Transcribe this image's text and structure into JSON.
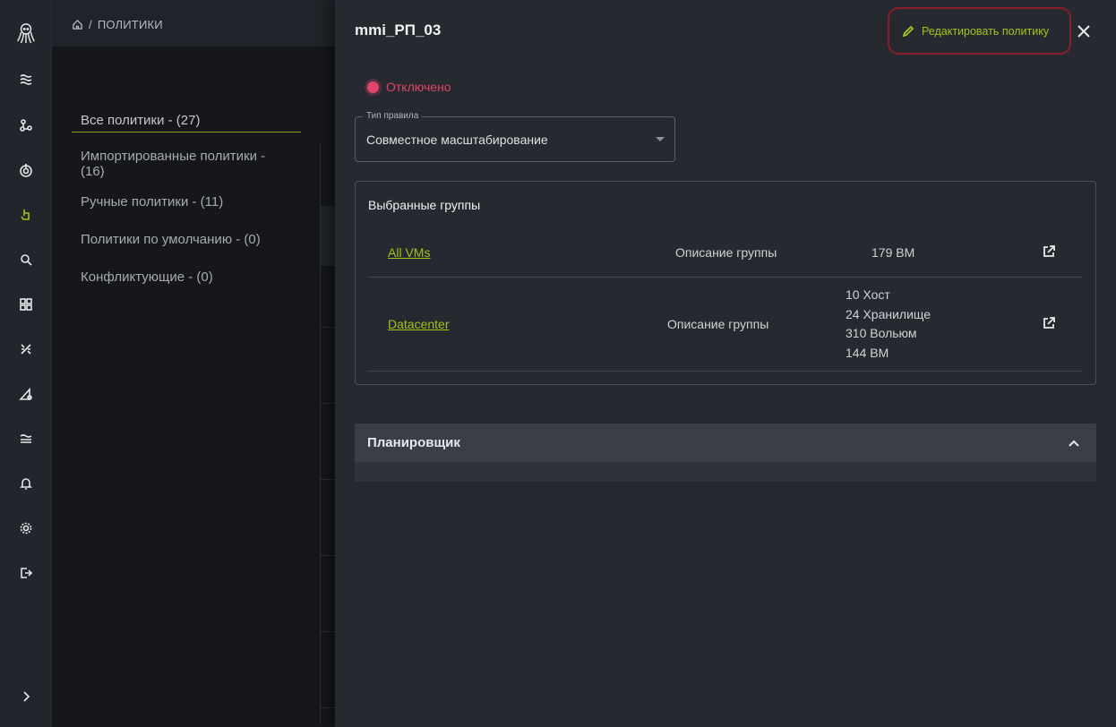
{
  "breadcrumb": {
    "home_icon": "home-icon",
    "separator": "/",
    "current": "ПОЛИТИКИ"
  },
  "categories": [
    {
      "label": "Все политики - (27)"
    },
    {
      "label": "Импортированные политики - (16)"
    },
    {
      "label": "Ручные политики - (11)"
    },
    {
      "label": "Политики по умолчанию - (0)"
    },
    {
      "label": "Конфликтующие - (0)"
    }
  ],
  "drawer": {
    "title": "mmi_РП_03",
    "edit_label": "Редактировать политику",
    "status": "Отключено",
    "rule_type": {
      "legend": "Тип правила",
      "value": "Совместное масштабирование"
    },
    "groups": {
      "heading": "Выбранные группы",
      "rows": [
        {
          "name": "All VMs",
          "description": "Описание группы",
          "stats": [
            "179 ВМ"
          ]
        },
        {
          "name": "Datacenter",
          "description": "Описание группы",
          "stats": [
            "10 Хост",
            "24 Хранилище",
            "310 Вольюм",
            "144 ВМ"
          ]
        }
      ]
    },
    "scheduler": {
      "label": "Планировщик"
    }
  },
  "colors": {
    "accent": "#a6c21c",
    "status_off": "#e0456a",
    "highlight_border": "#8a1d2c"
  }
}
